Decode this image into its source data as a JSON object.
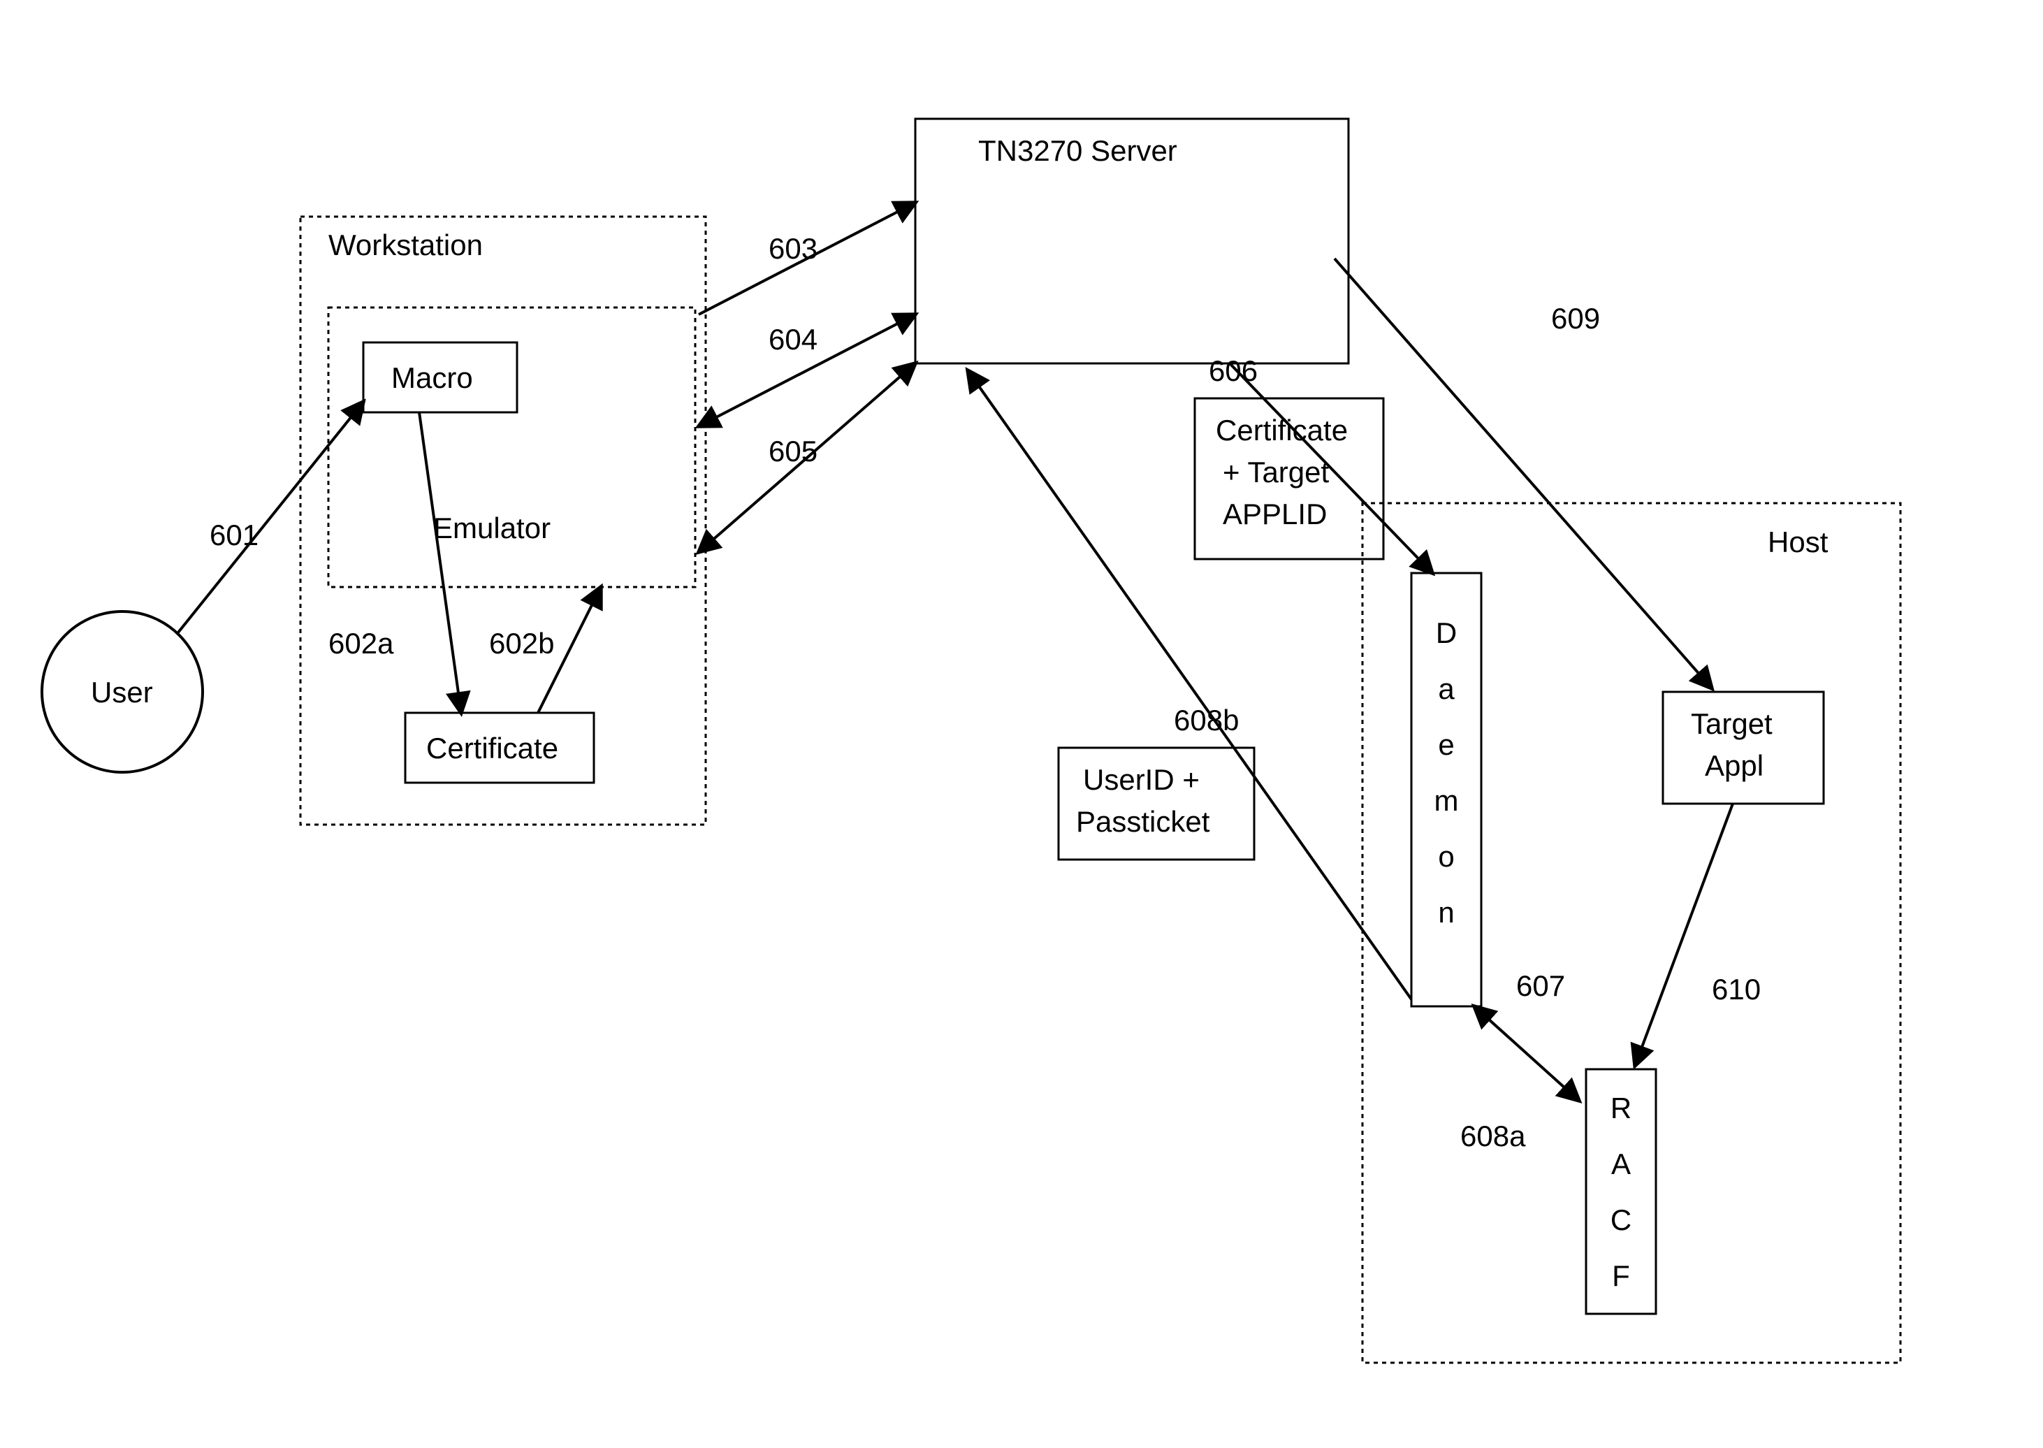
{
  "diagram": {
    "nodes": {
      "user": "User",
      "workstation": "Workstation",
      "macro": "Macro",
      "emulator": "Emulator",
      "certificate": "Certificate",
      "tn3270": "TN3270 Server",
      "cert_applid_l1": "Certificate",
      "cert_applid_l2": "+ Target",
      "cert_applid_l3": "APPLID",
      "userid_l1": "UserID +",
      "userid_l2": "Passticket",
      "host": "Host",
      "daemon": "Daemon",
      "racf": "RACF",
      "target_l1": "Target",
      "target_l2": "Appl"
    },
    "edges": {
      "e601": "601",
      "e602a": "602a",
      "e602b": "602b",
      "e603": "603",
      "e604": "604",
      "e605": "605",
      "e606": "606",
      "e607": "607",
      "e608a": "608a",
      "e608b": "608b",
      "e609": "609",
      "e610": "610"
    }
  }
}
